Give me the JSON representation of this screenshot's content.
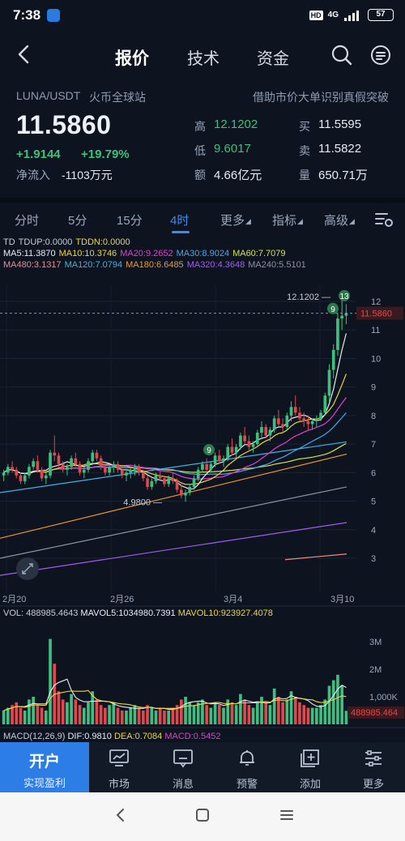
{
  "status_bar": {
    "time": "7:38",
    "hd": "HD",
    "network": "4G",
    "battery": "57"
  },
  "nav": {
    "tabs": [
      "报价",
      "技术",
      "资金"
    ],
    "active_tab": "报价"
  },
  "quote": {
    "pair": "LUNA/USDT",
    "exchange": "火币全球站",
    "banner": "借助市价大单识别真假突破",
    "price": "11.5860",
    "change": "+1.9144",
    "change_pct": "+19.79%",
    "net_inflow_label": "净流入",
    "net_inflow_value": "-1103万元",
    "high_label": "高",
    "high_value": "12.1202",
    "low_label": "低",
    "low_value": "9.6017",
    "amount_label": "额",
    "amount_value": "4.66亿元",
    "bid_label": "买",
    "bid_value": "11.5595",
    "ask_label": "卖",
    "ask_value": "11.5822",
    "volume_label": "量",
    "volume_value": "650.71万"
  },
  "periods": {
    "items": [
      "分时",
      "5分",
      "15分",
      "4时",
      "更多",
      "指标",
      "高级"
    ],
    "active": "4时"
  },
  "indicators": {
    "line1": [
      {
        "text": "TD",
        "color": "#c6cdd8"
      },
      {
        "text": "TDUP:0.0000",
        "color": "#c6cdd8"
      },
      {
        "text": "TDDN:0.0000",
        "color": "#f0d43a"
      }
    ],
    "line2": [
      {
        "text": "MA5:11.3870",
        "color": "#e8ecf2"
      },
      {
        "text": "MA10:10.3746",
        "color": "#f0d43a"
      },
      {
        "text": "MA20:9.2652",
        "color": "#e43fd2"
      },
      {
        "text": "MA30:8.9024",
        "color": "#4aa6f0"
      },
      {
        "text": "MA60:7.7079",
        "color": "#d5e14a"
      }
    ],
    "line3": [
      {
        "text": "MA480:3.1317",
        "color": "#f08a8a"
      },
      {
        "text": "MA120:7.0794",
        "color": "#3db4e8"
      },
      {
        "text": "MA180:6.6485",
        "color": "#f0962d"
      },
      {
        "text": "MA320:4.3648",
        "color": "#a55af0"
      },
      {
        "text": "MA240:5.5101",
        "color": "#8a93a2"
      }
    ],
    "volume_line": [
      {
        "text": "VOL: 488985.4643",
        "color": "#c6cdd8"
      },
      {
        "text": "MAVOL5:1034980.7391",
        "color": "#e8ecf2"
      },
      {
        "text": "MAVOL10:923927.4078",
        "color": "#f0d43a"
      }
    ],
    "macd_line": [
      {
        "text": "MACD(12,26,9)",
        "color": "#c6cdd8"
      },
      {
        "text": "DIF:0.9810",
        "color": "#e8ecf2"
      },
      {
        "text": "DEA:0.7084",
        "color": "#f0d43a"
      },
      {
        "text": "MACD:0.5452",
        "color": "#e43fd2"
      }
    ]
  },
  "chart_data": {
    "type": "candlestick",
    "price_axis_ticks": [
      "12",
      "11",
      "10",
      "9",
      "8",
      "7",
      "6",
      "5",
      "4",
      "3"
    ],
    "current_price_label": "11.5860",
    "high_marker_label": "12.1202",
    "low_marker_label": "4.9800",
    "td_markers": [
      "9",
      "9",
      "13"
    ],
    "date_labels": [
      "2月20",
      "2月26",
      "3月4",
      "3月10"
    ],
    "volume_axis_ticks": [
      "3M",
      "2M",
      "1,000K"
    ],
    "current_volume_label": "488985.464",
    "candles": [
      [
        5.9,
        6.1,
        5.7,
        6.0
      ],
      [
        6.0,
        6.3,
        5.9,
        6.2
      ],
      [
        6.2,
        6.4,
        6.0,
        6.1
      ],
      [
        6.1,
        6.2,
        5.8,
        5.9
      ],
      [
        5.9,
        6.0,
        5.6,
        5.7
      ],
      [
        5.7,
        6.0,
        5.6,
        5.9
      ],
      [
        5.9,
        6.3,
        5.8,
        6.2
      ],
      [
        6.2,
        6.5,
        6.1,
        6.4
      ],
      [
        6.4,
        6.6,
        6.0,
        6.1
      ],
      [
        6.1,
        6.2,
        5.7,
        5.8
      ],
      [
        5.8,
        6.0,
        5.6,
        5.9
      ],
      [
        5.9,
        6.8,
        5.8,
        6.7
      ],
      [
        6.7,
        7.3,
        6.4,
        6.6
      ],
      [
        6.6,
        6.7,
        6.2,
        6.3
      ],
      [
        6.3,
        6.4,
        6.0,
        6.1
      ],
      [
        6.1,
        6.3,
        5.9,
        6.2
      ],
      [
        6.2,
        6.6,
        6.1,
        6.5
      ],
      [
        6.5,
        6.7,
        6.2,
        6.3
      ],
      [
        6.3,
        6.4,
        5.9,
        6.0
      ],
      [
        6.0,
        6.2,
        5.8,
        6.1
      ],
      [
        6.1,
        6.5,
        6.0,
        6.4
      ],
      [
        6.4,
        6.8,
        6.3,
        6.7
      ],
      [
        6.7,
        6.8,
        6.4,
        6.5
      ],
      [
        6.5,
        6.6,
        6.1,
        6.2
      ],
      [
        6.2,
        6.3,
        5.9,
        6.0
      ],
      [
        6.0,
        6.3,
        5.9,
        6.2
      ],
      [
        6.2,
        6.4,
        6.0,
        6.3
      ],
      [
        6.3,
        6.4,
        6.0,
        6.1
      ],
      [
        6.1,
        6.2,
        5.8,
        5.9
      ],
      [
        5.9,
        6.1,
        5.7,
        6.0
      ],
      [
        6.0,
        6.2,
        5.8,
        6.1
      ],
      [
        6.1,
        6.3,
        5.9,
        6.2
      ],
      [
        6.2,
        6.3,
        5.9,
        6.0
      ],
      [
        6.0,
        6.1,
        5.7,
        5.8
      ],
      [
        5.8,
        5.9,
        5.4,
        5.5
      ],
      [
        5.5,
        5.8,
        5.4,
        5.7
      ],
      [
        5.7,
        6.0,
        5.6,
        5.9
      ],
      [
        5.9,
        6.1,
        5.7,
        5.8
      ],
      [
        5.8,
        5.9,
        5.5,
        5.6
      ],
      [
        5.6,
        5.9,
        5.5,
        5.8
      ],
      [
        5.8,
        6.0,
        5.6,
        5.7
      ],
      [
        5.7,
        5.8,
        5.3,
        5.4
      ],
      [
        5.4,
        5.6,
        5.1,
        5.2
      ],
      [
        5.2,
        5.4,
        4.98,
        5.3
      ],
      [
        5.3,
        5.6,
        5.2,
        5.5
      ],
      [
        5.5,
        5.9,
        5.4,
        5.8
      ],
      [
        5.8,
        6.2,
        5.7,
        6.1
      ],
      [
        6.1,
        6.4,
        6.0,
        6.3
      ],
      [
        6.3,
        6.5,
        6.0,
        6.1
      ],
      [
        6.1,
        6.4,
        6.0,
        6.3
      ],
      [
        6.3,
        6.7,
        6.2,
        6.6
      ],
      [
        6.6,
        6.8,
        6.3,
        6.4
      ],
      [
        6.4,
        6.6,
        6.2,
        6.5
      ],
      [
        6.5,
        7.0,
        6.4,
        6.9
      ],
      [
        6.9,
        7.2,
        6.6,
        6.7
      ],
      [
        6.7,
        7.0,
        6.5,
        6.9
      ],
      [
        6.9,
        7.4,
        6.8,
        7.3
      ],
      [
        7.3,
        7.6,
        7.0,
        7.1
      ],
      [
        7.1,
        7.3,
        6.8,
        6.9
      ],
      [
        6.9,
        7.1,
        6.7,
        7.0
      ],
      [
        7.0,
        7.5,
        6.9,
        7.4
      ],
      [
        7.4,
        7.8,
        7.2,
        7.6
      ],
      [
        7.6,
        7.7,
        7.2,
        7.3
      ],
      [
        7.3,
        7.6,
        7.1,
        7.5
      ],
      [
        7.5,
        8.0,
        7.4,
        7.9
      ],
      [
        7.9,
        8.2,
        7.6,
        7.7
      ],
      [
        7.7,
        7.9,
        7.4,
        7.6
      ],
      [
        7.6,
        8.1,
        7.5,
        8.0
      ],
      [
        8.0,
        8.5,
        7.8,
        8.3
      ],
      [
        8.3,
        8.7,
        8.0,
        8.1
      ],
      [
        8.1,
        8.3,
        7.8,
        7.9
      ],
      [
        7.9,
        8.1,
        7.6,
        7.8
      ],
      [
        7.8,
        8.0,
        7.5,
        7.7
      ],
      [
        7.7,
        7.9,
        7.5,
        7.8
      ],
      [
        7.8,
        8.0,
        7.6,
        7.9
      ],
      [
        7.9,
        8.2,
        7.8,
        8.1
      ],
      [
        8.1,
        8.8,
        8.0,
        8.7
      ],
      [
        8.7,
        9.8,
        8.5,
        9.6
      ],
      [
        9.6,
        10.5,
        9.3,
        10.3
      ],
      [
        10.3,
        11.6,
        10.1,
        11.4
      ],
      [
        11.4,
        12.1202,
        11.0,
        11.5
      ],
      [
        11.5,
        11.9,
        11.2,
        11.586
      ]
    ],
    "volume": [
      0.5,
      0.6,
      0.7,
      0.8,
      0.6,
      0.5,
      0.9,
      1.0,
      0.7,
      0.6,
      0.5,
      3.1,
      2.2,
      1.2,
      0.9,
      0.8,
      1.1,
      0.9,
      0.7,
      0.6,
      0.8,
      1.2,
      0.9,
      0.7,
      0.6,
      0.7,
      0.8,
      0.6,
      0.5,
      0.5,
      0.6,
      0.7,
      0.6,
      0.5,
      0.7,
      0.6,
      0.5,
      0.6,
      0.5,
      0.5,
      0.6,
      0.7,
      0.9,
      1.0,
      0.8,
      0.7,
      0.8,
      0.9,
      0.7,
      0.6,
      0.8,
      0.7,
      0.6,
      0.9,
      0.8,
      0.7,
      1.1,
      0.9,
      0.7,
      0.6,
      0.8,
      1.0,
      0.8,
      0.7,
      1.3,
      1.0,
      0.8,
      0.9,
      1.2,
      1.0,
      0.8,
      0.7,
      0.6,
      0.6,
      0.6,
      0.7,
      0.9,
      1.4,
      1.6,
      1.8,
      1.4,
      0.49
    ]
  },
  "tabbar": {
    "open_account": "开户",
    "open_sub": "实现盈利",
    "items": [
      {
        "label": "市场",
        "icon": "chart-monitor-icon"
      },
      {
        "label": "消息",
        "icon": "message-icon"
      },
      {
        "label": "预警",
        "icon": "bell-icon"
      },
      {
        "label": "添加",
        "icon": "add-icon"
      },
      {
        "label": "更多",
        "icon": "more-settings-icon"
      }
    ]
  },
  "colors": {
    "up": "#3fbf7f",
    "down": "#e0484d",
    "accent": "#3d8bf2",
    "background": "#0d1420"
  }
}
